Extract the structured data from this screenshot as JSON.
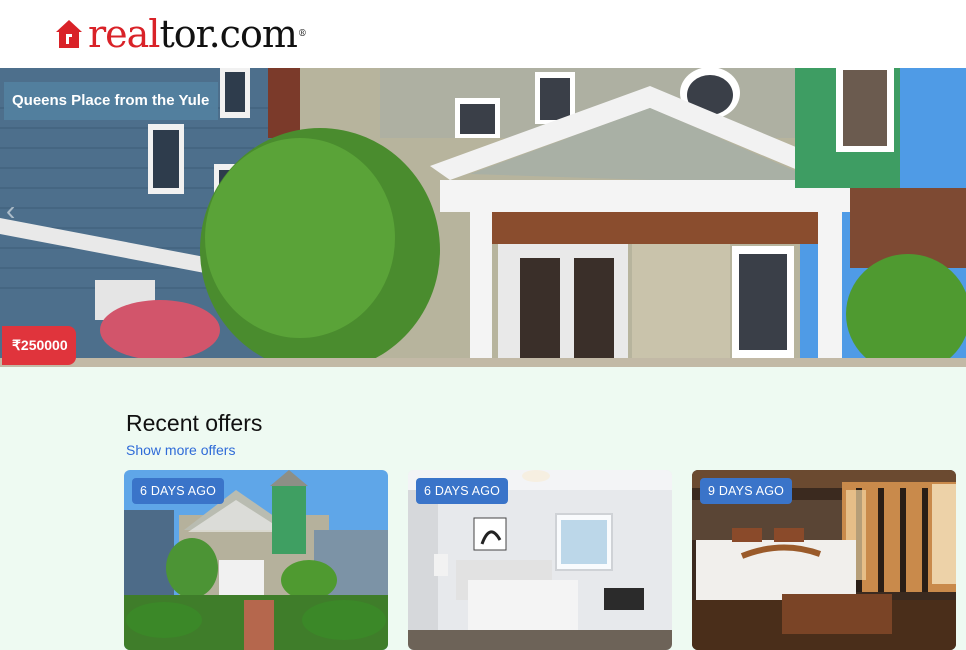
{
  "brand": {
    "name_part1": "real",
    "name_part2": "tor.com",
    "reg": "®",
    "accent_color": "#d92228"
  },
  "hero": {
    "title": "Queens Place from the Yule",
    "price": "₹250000",
    "prev_icon": "chevron-left-icon"
  },
  "recent": {
    "title": "Recent offers",
    "show_more": "Show more offers",
    "cards": [
      {
        "badge": "6 DAYS AGO",
        "image": "victorian-house-photo"
      },
      {
        "badge": "6 DAYS AGO",
        "image": "white-bedroom-photo"
      },
      {
        "badge": "9 DAYS AGO",
        "image": "wooden-bedroom-photo"
      }
    ]
  }
}
